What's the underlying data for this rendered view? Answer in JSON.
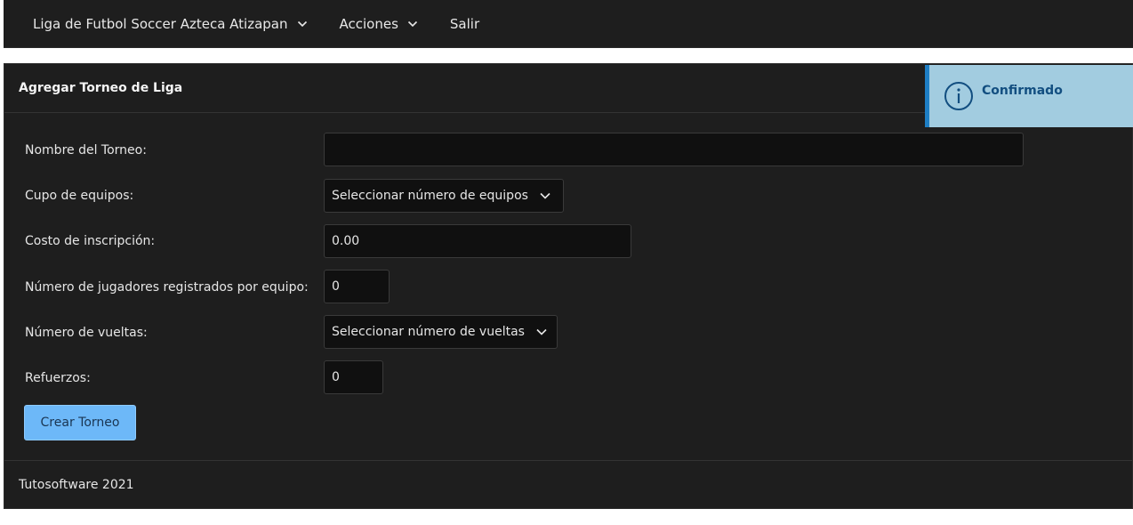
{
  "navbar": {
    "items": [
      {
        "label": "Liga de Futbol Soccer Azteca Atizapan",
        "icon": "chevron-down-icon"
      },
      {
        "label": "Acciones",
        "icon": "chevron-down-icon"
      },
      {
        "label": "Salir"
      }
    ]
  },
  "card": {
    "title": "Agregar Torneo de Liga",
    "fields": [
      {
        "label": "Nombre del Torneo:",
        "value": ""
      },
      {
        "label": "Cupo de equipos:",
        "value": "Seleccionar número de equipos",
        "icon": "chevron-down-icon"
      },
      {
        "label": "Costo de inscripción:",
        "value": "0.00"
      },
      {
        "label": "Número de jugadores registrados por equipo:",
        "value": "0"
      },
      {
        "label": "Número de vueltas:",
        "value": "Seleccionar número de vueltas",
        "icon": "chevron-down-icon"
      },
      {
        "label": "Refuerzos:",
        "value": "0"
      }
    ],
    "submit_label": "Crear Torneo",
    "footer": "Tutosoftware 2021"
  },
  "toast": {
    "title": "Confirmado",
    "icon": "info-icon"
  },
  "colors": {
    "background": "#1e1e1e",
    "input_bg": "#101010",
    "primary": "#6db8f8",
    "toast_bg": "#a2cce0",
    "toast_accent": "#1e7ec4"
  }
}
